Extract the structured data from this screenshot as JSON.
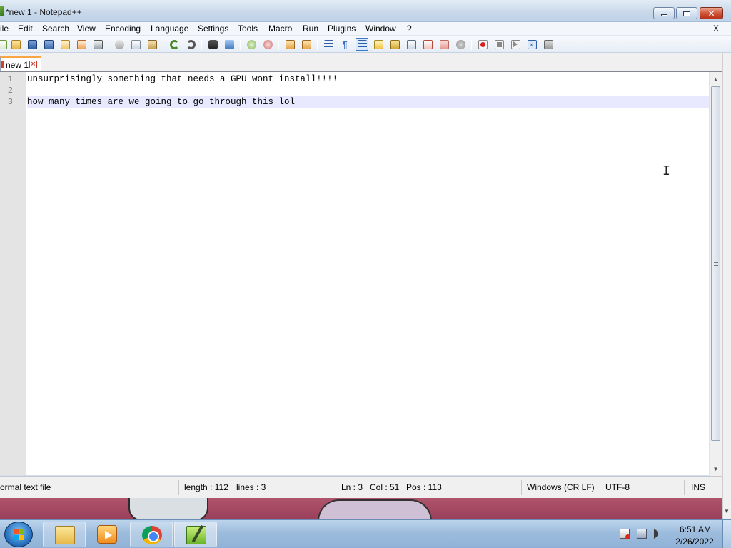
{
  "window": {
    "title": "*new 1 - Notepad++",
    "controls": {
      "minimize_icon": "minimize-icon",
      "maximize_icon": "maximize-icon",
      "close_glyph": "✕"
    }
  },
  "menu": {
    "items": [
      "ile",
      "Edit",
      "Search",
      "View",
      "Encoding",
      "Language",
      "Settings",
      "Tools",
      "Macro",
      "Run",
      "Plugins",
      "Window",
      "?"
    ],
    "close_doc": "X"
  },
  "toolbar": {
    "icons": [
      "new-file-icon",
      "open-file-icon",
      "save-icon",
      "save-all-icon",
      "close-icon",
      "close-all-icon",
      "print-icon",
      "cut-icon",
      "copy-icon",
      "paste-icon",
      "undo-icon",
      "redo-icon",
      "find-icon",
      "replace-icon",
      "zoom-in-icon",
      "zoom-out-icon",
      "sync-vertical-icon",
      "sync-horizontal-icon",
      "word-wrap-icon",
      "show-all-chars-icon",
      "indent-guide-icon",
      "user-language-icon",
      "doc-map-icon",
      "function-list-icon",
      "folder-workspace-icon",
      "monitoring-icon",
      "doc-list-icon",
      "record-macro-icon",
      "stop-record-icon",
      "play-macro-icon",
      "run-macro-multiple-icon",
      "save-macro-icon"
    ],
    "active_icon": "indent-guide-icon"
  },
  "tabs": [
    {
      "label": "new 1",
      "close_glyph": "×",
      "modified": true
    }
  ],
  "editor": {
    "lines": [
      {
        "number": "1",
        "text": "unsurprisingly something that needs a GPU wont install!!!!"
      },
      {
        "number": "2",
        "text": ""
      },
      {
        "number": "3",
        "text": "how many times are we going to go through this lol"
      }
    ],
    "current_line": 3,
    "scroll_up": "▲",
    "scroll_down": "▼"
  },
  "status": {
    "file_type": "ormal text file",
    "length": "length : 112",
    "lines": "lines : 3",
    "ln": "Ln : 3",
    "col": "Col : 51",
    "pos": "Pos : 113",
    "eol": "Windows (CR LF)",
    "encoding": "UTF-8",
    "mode": "INS"
  },
  "taskbar": {
    "apps": [
      "windows-explorer-icon",
      "media-player-icon",
      "chrome-icon",
      "notepad-plus-plus-icon"
    ],
    "tray_icons": [
      "action-center-flag-icon",
      "network-icon",
      "volume-icon"
    ],
    "time": "6:51 AM",
    "date": "2/26/2022"
  },
  "colors": {
    "title_gradient_top": "#e3ecf6",
    "current_line_highlight": "#e8e8ff",
    "gutter": "#e4e4e4",
    "tab_accent": "#f7a642",
    "close_button": "#d0553a"
  }
}
